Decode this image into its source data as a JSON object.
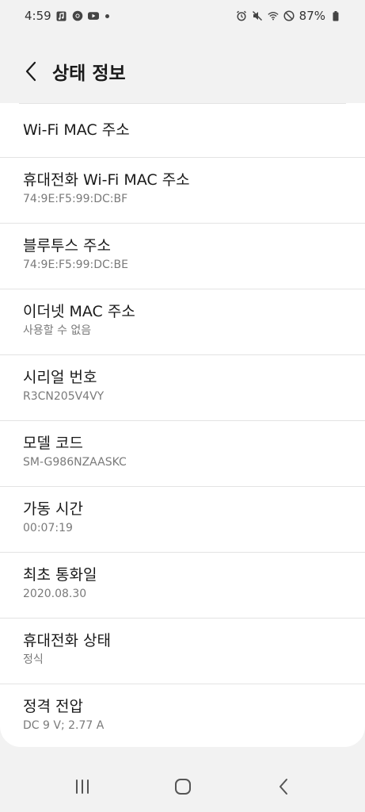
{
  "status_bar": {
    "time": "4:59",
    "battery": "87%",
    "left_icons": [
      "music-note-icon",
      "chrome-icon",
      "youtube-icon",
      "notification-dot-icon"
    ],
    "right_icons": [
      "alarm-icon",
      "mute-icon",
      "wifi-icon",
      "do-not-disturb-icon",
      "battery-icon"
    ]
  },
  "header": {
    "title": "상태 정보",
    "back_icon": "chevron-left-icon"
  },
  "items": [
    {
      "title": "Wi-Fi MAC 주소",
      "subtitle": ""
    },
    {
      "title": "휴대전화 Wi-Fi MAC 주소",
      "subtitle": "74:9E:F5:99:DC:BF"
    },
    {
      "title": "블루투스 주소",
      "subtitle": "74:9E:F5:99:DC:BE"
    },
    {
      "title": "이더넷 MAC 주소",
      "subtitle": "사용할 수 없음"
    },
    {
      "title": "시리얼 번호",
      "subtitle": "R3CN205V4VY"
    },
    {
      "title": "모델 코드",
      "subtitle": "SM-G986NZAASKC"
    },
    {
      "title": "가동 시간",
      "subtitle": "00:07:19"
    },
    {
      "title": "최초 통화일",
      "subtitle": "2020.08.30"
    },
    {
      "title": "휴대전화 상태",
      "subtitle": "정식"
    },
    {
      "title": "정격 전압",
      "subtitle": "DC 9 V; 2.77 A"
    }
  ],
  "nav_bar": {
    "buttons": [
      "recent-apps-icon",
      "home-icon",
      "back-icon"
    ]
  }
}
